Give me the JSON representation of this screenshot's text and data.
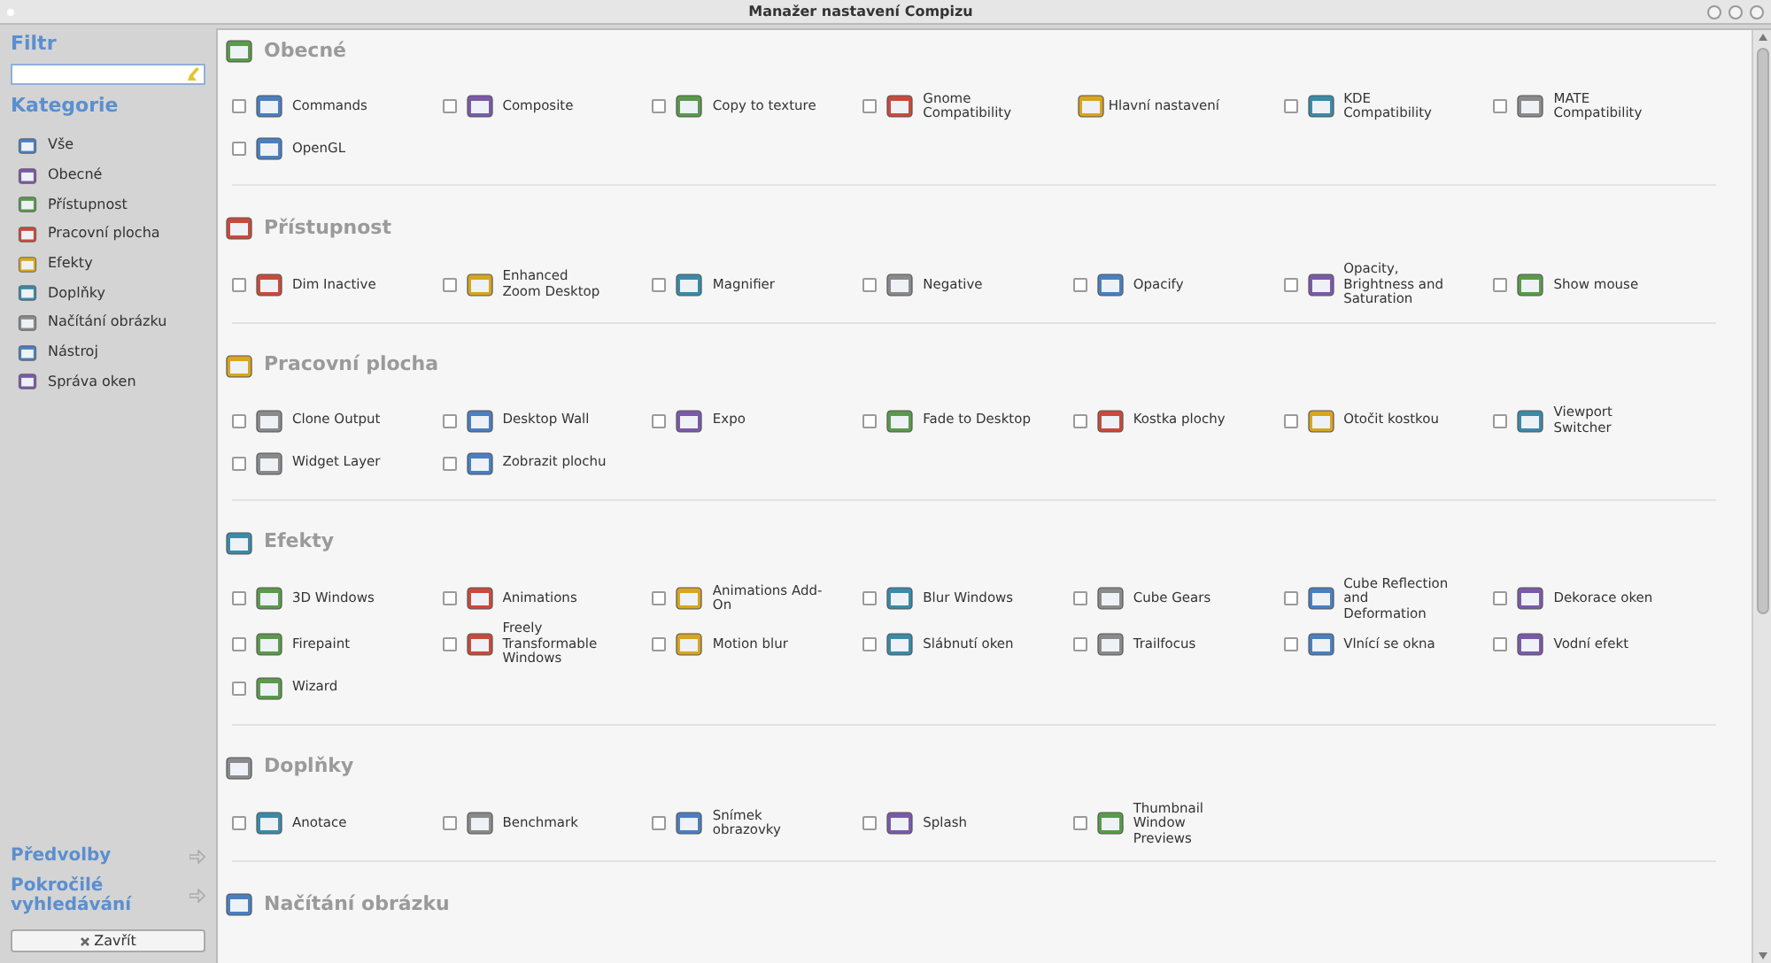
{
  "window": {
    "title": "Manažer nastavení Compizu"
  },
  "sidebar": {
    "filter_heading": "Filtr",
    "categories_heading": "Kategorie",
    "categories": [
      {
        "label": "Vše",
        "selected": false
      },
      {
        "label": "Obecné",
        "selected": false
      },
      {
        "label": "Přístupnost",
        "selected": false
      },
      {
        "label": "Pracovní plocha",
        "selected": false
      },
      {
        "label": "Efekty",
        "selected": false
      },
      {
        "label": "Doplňky",
        "selected": false
      },
      {
        "label": "Načítání obrázku",
        "selected": false
      },
      {
        "label": "Nástroj",
        "selected": false
      },
      {
        "label": "Správa oken",
        "selected": false
      }
    ],
    "links": [
      {
        "label": "Předvolby"
      },
      {
        "label": "Pokročilé\nvyhledávání"
      }
    ],
    "close_button": "Zavřít"
  },
  "sections": [
    {
      "title": "Obecné",
      "plugins": [
        {
          "kind": "checkbox",
          "label": "Commands",
          "checked": false
        },
        {
          "kind": "checkbox",
          "label": "Composite",
          "checked": false
        },
        {
          "kind": "checkbox",
          "label": "Copy to texture",
          "checked": false
        },
        {
          "kind": "checkbox",
          "label": "Gnome\nCompatibility",
          "checked": false
        },
        {
          "kind": "plain",
          "label": "Hlavní nastavení"
        },
        {
          "kind": "checkbox",
          "label": "KDE\nCompatibility",
          "checked": false
        },
        {
          "kind": "checkbox",
          "label": "MATE\nCompatibility",
          "checked": false
        },
        {
          "kind": "checkbox",
          "label": "OpenGL",
          "checked": false
        }
      ]
    },
    {
      "title": "Přístupnost",
      "plugins": [
        {
          "kind": "checkbox",
          "label": "Dim Inactive",
          "checked": false
        },
        {
          "kind": "checkbox",
          "label": "Enhanced\nZoom Desktop",
          "checked": false
        },
        {
          "kind": "checkbox",
          "label": "Magnifier",
          "checked": false
        },
        {
          "kind": "checkbox",
          "label": "Negative",
          "checked": false
        },
        {
          "kind": "checkbox",
          "label": "Opacify",
          "checked": false
        },
        {
          "kind": "checkbox",
          "label": "Opacity,\nBrightness and\nSaturation",
          "checked": false
        },
        {
          "kind": "checkbox",
          "label": "Show mouse",
          "checked": false
        }
      ]
    },
    {
      "title": "Pracovní plocha",
      "plugins": [
        {
          "kind": "checkbox",
          "label": "Clone Output",
          "checked": false
        },
        {
          "kind": "checkbox",
          "label": "Desktop Wall",
          "checked": false
        },
        {
          "kind": "checkbox",
          "label": "Expo",
          "checked": false
        },
        {
          "kind": "checkbox",
          "label": "Fade to Desktop",
          "checked": false
        },
        {
          "kind": "checkbox",
          "label": "Kostka plochy",
          "checked": false
        },
        {
          "kind": "checkbox",
          "label": "Otočit kostkou",
          "checked": false
        },
        {
          "kind": "checkbox",
          "label": "Viewport\nSwitcher",
          "checked": false
        },
        {
          "kind": "checkbox",
          "label": "Widget Layer",
          "checked": false
        },
        {
          "kind": "checkbox",
          "label": "Zobrazit plochu",
          "checked": false
        }
      ]
    },
    {
      "title": "Efekty",
      "plugins": [
        {
          "kind": "checkbox",
          "label": "3D Windows",
          "checked": false
        },
        {
          "kind": "checkbox",
          "label": "Animations",
          "checked": false
        },
        {
          "kind": "checkbox",
          "label": "Animations Add-\nOn",
          "checked": false
        },
        {
          "kind": "checkbox",
          "label": "Blur Windows",
          "checked": false
        },
        {
          "kind": "checkbox",
          "label": "Cube Gears",
          "checked": false
        },
        {
          "kind": "checkbox",
          "label": "Cube Reflection\nand\nDeformation",
          "checked": false
        },
        {
          "kind": "checkbox",
          "label": "Dekorace oken",
          "checked": false
        },
        {
          "kind": "checkbox",
          "label": "Firepaint",
          "checked": false
        },
        {
          "kind": "checkbox",
          "label": "Freely\nTransformable\nWindows",
          "checked": false
        },
        {
          "kind": "checkbox",
          "label": "Motion blur",
          "checked": false
        },
        {
          "kind": "checkbox",
          "label": "Slábnutí oken",
          "checked": false
        },
        {
          "kind": "checkbox",
          "label": "Trailfocus",
          "checked": false
        },
        {
          "kind": "checkbox",
          "label": "Vlnící se okna",
          "checked": false
        },
        {
          "kind": "checkbox",
          "label": "Vodní efekt",
          "checked": false
        },
        {
          "kind": "checkbox",
          "label": "Wizard",
          "checked": false
        }
      ]
    },
    {
      "title": "Doplňky",
      "plugins": [
        {
          "kind": "checkbox",
          "label": "Anotace",
          "checked": false
        },
        {
          "kind": "checkbox",
          "label": "Benchmark",
          "checked": false
        },
        {
          "kind": "checkbox",
          "label": "Snímek\nobrazovky",
          "checked": false
        },
        {
          "kind": "checkbox",
          "label": "Splash",
          "checked": false
        },
        {
          "kind": "checkbox",
          "label": "Thumbnail\nWindow\nPreviews",
          "checked": false
        }
      ]
    },
    {
      "title": "Načítání obrázku"
    }
  ]
}
